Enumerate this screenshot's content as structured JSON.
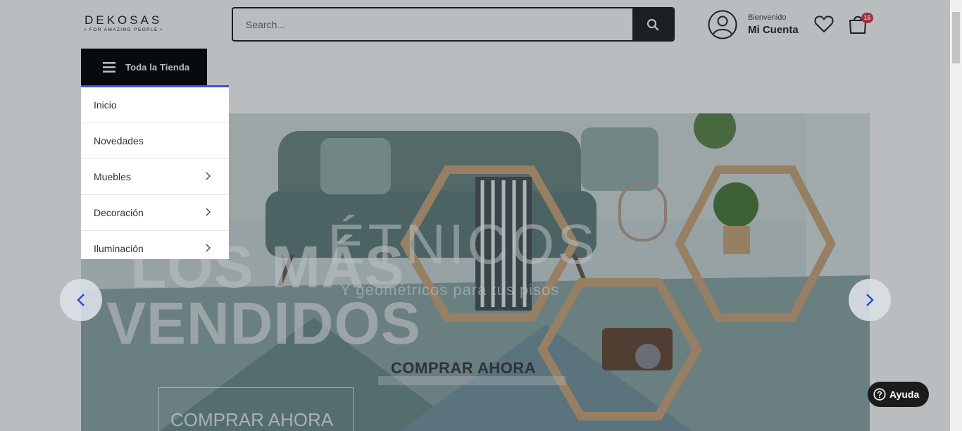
{
  "header": {
    "logo": {
      "brand": "DEKOSAS",
      "tagline": "• FOR AMAZING PEOPLE •"
    },
    "search": {
      "placeholder": "Search..."
    },
    "account": {
      "greeting": "Bienvenido",
      "label": "Mi Cuenta"
    },
    "cart": {
      "count": "16"
    }
  },
  "store_menu": {
    "button_label": "Toda la Tienda",
    "items": [
      {
        "label": "Inicio",
        "has_submenu": false
      },
      {
        "label": "Novedades",
        "has_submenu": false
      },
      {
        "label": "Muebles",
        "has_submenu": true
      },
      {
        "label": "Decoración",
        "has_submenu": true
      },
      {
        "label": "Iluminación",
        "has_submenu": true
      }
    ]
  },
  "hero": {
    "headline_line1": "LOS MÁS",
    "headline_line2": "VENDIDOS",
    "overlay_title": "ÉTNICOS",
    "overlay_subtitle": "Y geométricos para tus pisos",
    "cta_primary": "COMPRAR AHORA",
    "cta_secondary": "COMPRAR AHORA"
  },
  "help": {
    "label": "Ayuda"
  },
  "colors": {
    "accent": "#3b56d9",
    "dark": "#1d1d1d",
    "badge": "#e0393e"
  },
  "icons": [
    "search-icon",
    "user-icon",
    "heart-icon",
    "shopping-bag-icon",
    "menu-icon",
    "chevron-right-icon",
    "chevron-left-icon",
    "question-icon"
  ]
}
